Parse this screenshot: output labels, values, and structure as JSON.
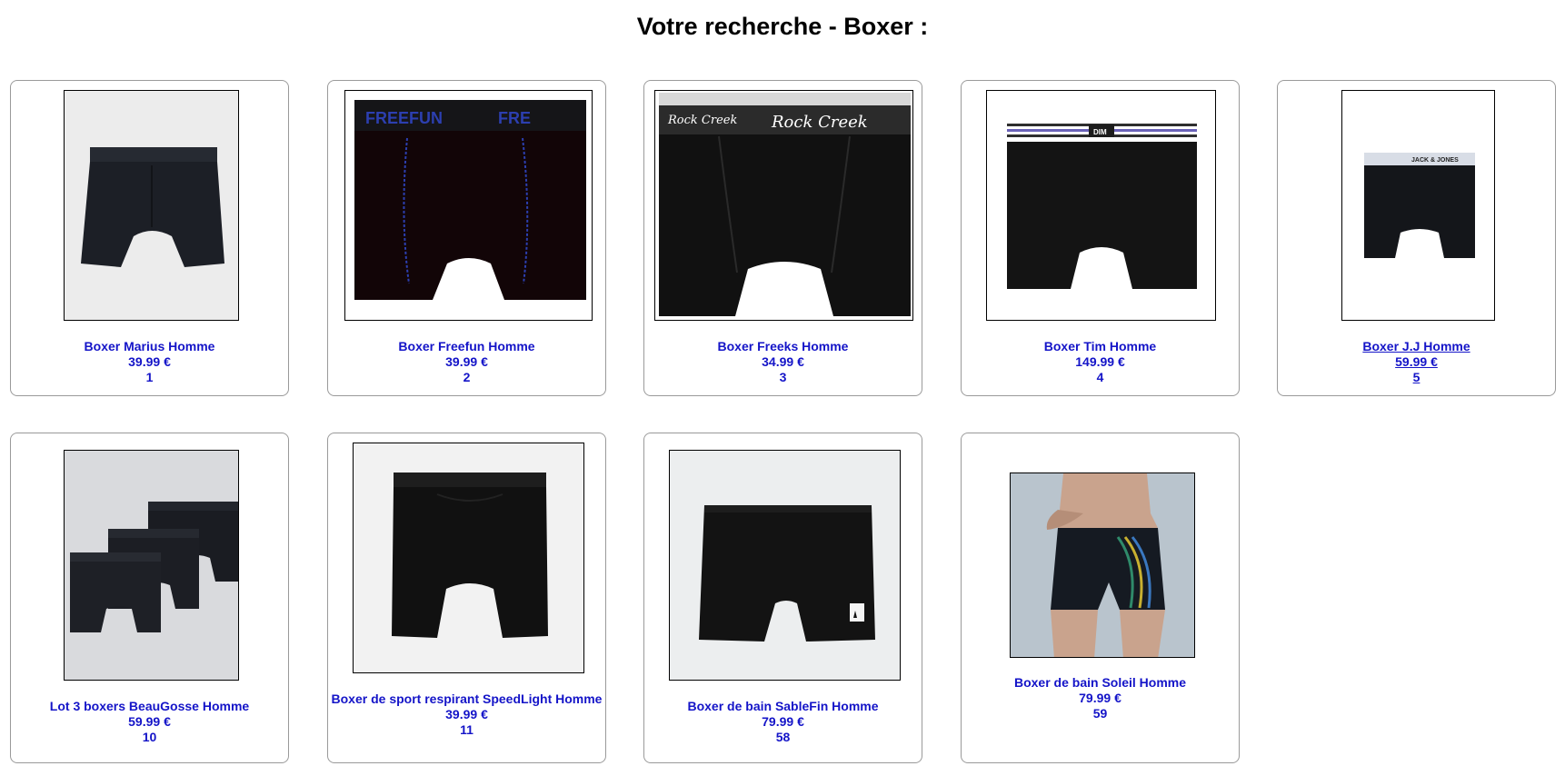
{
  "page_title": "Votre recherche - Boxer :",
  "products": [
    {
      "name": "Boxer Marius Homme",
      "price": "39.99 €",
      "id": "1"
    },
    {
      "name": "Boxer Freefun Homme",
      "price": "39.99 €",
      "id": "2",
      "brand_text": "FREEFUN"
    },
    {
      "name": "Boxer Freeks Homme",
      "price": "34.99 €",
      "id": "3",
      "brand_text": "Rock Creek"
    },
    {
      "name": "Boxer Tim Homme",
      "price": "149.99 €",
      "id": "4",
      "brand_text": "DIM"
    },
    {
      "name": "Boxer J.J Homme",
      "price": "59.99 €",
      "id": "5",
      "brand_text": "JACK & JONES"
    },
    {
      "name": "Lot 3 boxers BeauGosse Homme",
      "price": "59.99 €",
      "id": "10"
    },
    {
      "name": "Boxer de sport respirant SpeedLight Homme",
      "price": "39.99 €",
      "id": "11"
    },
    {
      "name": "Boxer de bain SableFin Homme",
      "price": "79.99 €",
      "id": "58"
    },
    {
      "name": "Boxer de bain Soleil Homme",
      "price": "79.99 €",
      "id": "59"
    }
  ],
  "colors": {
    "link": "#1414c8",
    "card_border": "#9a9a9a"
  }
}
